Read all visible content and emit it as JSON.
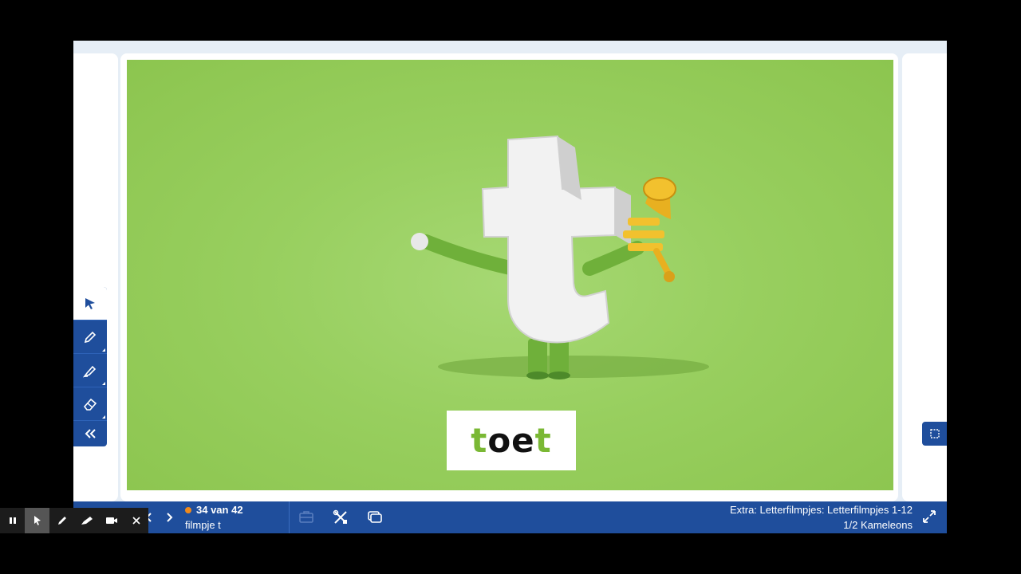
{
  "video": {
    "word_parts": [
      {
        "text": "t",
        "color": "#7ab834"
      },
      {
        "text": "oe",
        "color": "#111111"
      },
      {
        "text": "t",
        "color": "#7ab834"
      }
    ],
    "background_color": "#98cf5f",
    "illustration": "letter-t-character-with-trumpet"
  },
  "toolbox": {
    "tools": [
      "pointer-icon",
      "pencil-icon",
      "highlighter-icon",
      "eraser-icon",
      "double-chevron-left-icon"
    ]
  },
  "navigation": {
    "counter": "34 van 42",
    "slide_title": "filmpje t",
    "status_color": "#f08a1c"
  },
  "breadcrumb": {
    "line1": "Extra: Letterfilmpjes: Letterfilmpjes 1-12",
    "line2": "1/2 Kameleons"
  },
  "colors": {
    "accent": "#1f4e9c",
    "frame": "#e6eef6"
  },
  "recorder": {
    "buttons": [
      "pause-icon",
      "cursor-icon",
      "pen-icon",
      "marker-icon",
      "camera-icon",
      "close-icon"
    ]
  }
}
